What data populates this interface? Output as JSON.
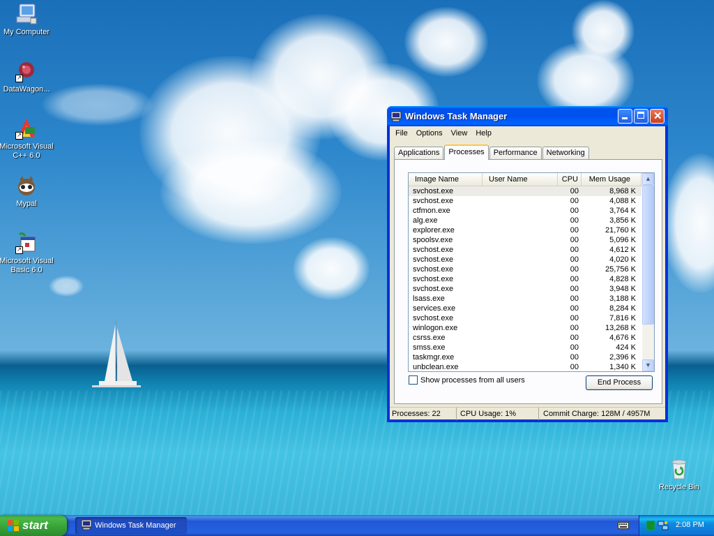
{
  "desktop": {
    "icons": [
      {
        "label": "My Computer",
        "icon": "my-computer-icon"
      },
      {
        "label": "DataWagon...",
        "icon": "datawagon-icon"
      },
      {
        "label": "Microsoft Visual C++ 6.0",
        "icon": "visual-cpp-icon"
      },
      {
        "label": "Mypal",
        "icon": "mypal-icon"
      },
      {
        "label": "Microsoft Visual Basic 6.0",
        "icon": "visual-basic-icon"
      },
      {
        "label": "Recycle Bin",
        "icon": "recycle-bin-icon"
      }
    ]
  },
  "window": {
    "title": "Windows Task Manager",
    "menu": [
      "File",
      "Options",
      "View",
      "Help"
    ],
    "tabs": [
      "Applications",
      "Processes",
      "Performance",
      "Networking"
    ],
    "active_tab": "Processes",
    "columns": [
      "Image Name",
      "User Name",
      "CPU",
      "Mem Usage"
    ],
    "processes": [
      {
        "name": "svchost.exe",
        "user": "",
        "cpu": "00",
        "mem": "8,968 K"
      },
      {
        "name": "svchost.exe",
        "user": "",
        "cpu": "00",
        "mem": "4,088 K"
      },
      {
        "name": "ctfmon.exe",
        "user": "",
        "cpu": "00",
        "mem": "3,764 K"
      },
      {
        "name": "alg.exe",
        "user": "",
        "cpu": "00",
        "mem": "3,856 K"
      },
      {
        "name": "explorer.exe",
        "user": "",
        "cpu": "00",
        "mem": "21,760 K"
      },
      {
        "name": "spoolsv.exe",
        "user": "",
        "cpu": "00",
        "mem": "5,096 K"
      },
      {
        "name": "svchost.exe",
        "user": "",
        "cpu": "00",
        "mem": "4,612 K"
      },
      {
        "name": "svchost.exe",
        "user": "",
        "cpu": "00",
        "mem": "4,020 K"
      },
      {
        "name": "svchost.exe",
        "user": "",
        "cpu": "00",
        "mem": "25,756 K"
      },
      {
        "name": "svchost.exe",
        "user": "",
        "cpu": "00",
        "mem": "4,828 K"
      },
      {
        "name": "svchost.exe",
        "user": "",
        "cpu": "00",
        "mem": "3,948 K"
      },
      {
        "name": "lsass.exe",
        "user": "",
        "cpu": "00",
        "mem": "3,188 K"
      },
      {
        "name": "services.exe",
        "user": "",
        "cpu": "00",
        "mem": "8,284 K"
      },
      {
        "name": "svchost.exe",
        "user": "",
        "cpu": "00",
        "mem": "7,816 K"
      },
      {
        "name": "winlogon.exe",
        "user": "",
        "cpu": "00",
        "mem": "13,268 K"
      },
      {
        "name": "csrss.exe",
        "user": "",
        "cpu": "00",
        "mem": "4,676 K"
      },
      {
        "name": "smss.exe",
        "user": "",
        "cpu": "00",
        "mem": "424 K"
      },
      {
        "name": "taskmgr.exe",
        "user": "",
        "cpu": "00",
        "mem": "2,396 K"
      },
      {
        "name": "unbclean.exe",
        "user": "",
        "cpu": "00",
        "mem": "1,340 K"
      }
    ],
    "show_all_users_label": "Show processes from all users",
    "end_process_label": "End Process",
    "status": {
      "processes": "Processes: 22",
      "cpu": "CPU Usage: 1%",
      "commit": "Commit Charge: 128M / 4957M"
    }
  },
  "taskbar": {
    "start_label": "start",
    "items": [
      "Windows Task Manager"
    ],
    "clock": "2:08 PM"
  },
  "colors": {
    "title_bar": "#0053ee",
    "taskbar": "#2157d7",
    "start_button": "#37a137",
    "window_face": "#ece9d8"
  }
}
